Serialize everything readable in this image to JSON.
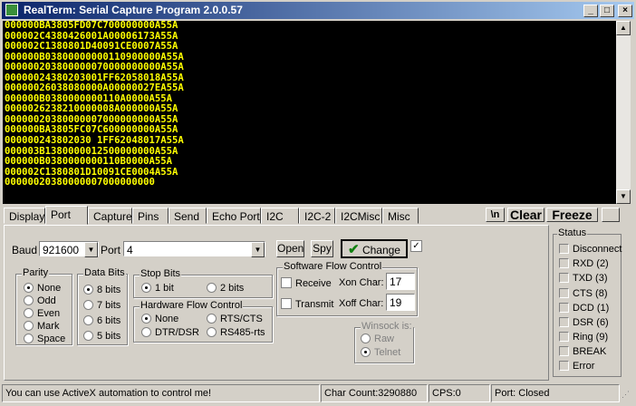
{
  "window": {
    "title": "RealTerm: Serial Capture Program 2.0.0.57",
    "min": "_",
    "max": "□",
    "close": "×"
  },
  "terminal": {
    "lines": [
      "000000BA3805FD07C700000000A55A",
      "000002C4380426001A00006173A55A",
      "000002C1380801D40091CE0007A55A",
      "000000B03800000000110900000A55A",
      "000000203800000070000000000A55A",
      "00000024380203001FF62058018A55A",
      "00000026038080000A00000027EA55A",
      "000000B0380000000110A0000A55A",
      "0000026238210000008A000000A55A",
      "00000020380000007000000000A55A",
      "000000BA3805FC07C600000000A55A",
      "000000243802030 1FF62048017A55A",
      "000003B1380000012500000000A55A",
      "000000B0380000000110B0000A55A",
      "000002C1380801D10091CE0004A55A",
      "00000020380000007000000000"
    ],
    "scroll_up": "▲",
    "scroll_down": "▼"
  },
  "tabs": [
    "Display",
    "Port",
    "Capture",
    "Pins",
    "Send",
    "Echo Port",
    "I2C",
    "I2C-2",
    "I2CMisc",
    "Misc"
  ],
  "right_buttons": {
    "newline": "\\n",
    "clear": "Clear",
    "freeze": "Freeze"
  },
  "port": {
    "baud_label": "Baud",
    "baud_value": "921600",
    "port_label": "Port",
    "port_value": "4",
    "open": "Open",
    "spy": "Spy",
    "change": "Change",
    "parity": {
      "label": "Parity",
      "options": [
        "None",
        "Odd",
        "Even",
        "Mark",
        "Space"
      ]
    },
    "data_bits": {
      "label": "Data Bits",
      "options": [
        "8 bits",
        "7 bits",
        "6 bits",
        "5 bits"
      ]
    },
    "stop_bits": {
      "label": "Stop Bits",
      "one": "1 bit",
      "two": "2 bits"
    },
    "hw_flow": {
      "label": "Hardware Flow Control",
      "none": "None",
      "rts_cts": "RTS/CTS",
      "dtr_dsr": "DTR/DSR",
      "rs485": "RS485-rts"
    },
    "sw_flow": {
      "label": "Software Flow Control",
      "receive": "Receive",
      "xon_label": "Xon Char:",
      "xon": "17",
      "transmit": "Transmit",
      "xoff_label": "Xoff Char:",
      "xoff": "19"
    },
    "winsock": {
      "label": "Winsock is:",
      "raw": "Raw",
      "telnet": "Telnet"
    }
  },
  "status": {
    "label": "Status",
    "items": [
      "Disconnect",
      "RXD (2)",
      "TXD (3)",
      "CTS (8)",
      "DCD (1)",
      "DSR (6)",
      "Ring (9)",
      "BREAK",
      "Error"
    ]
  },
  "statusbar": {
    "message": "You can use ActiveX automation to control me!",
    "char_count": "Char Count:3290880",
    "cps": "CPS:0",
    "port": "Port: Closed"
  },
  "colors": {
    "terminal_bg": "#000000",
    "terminal_text": "#ffff00",
    "title_start": "#0a246a",
    "title_end": "#a6caf0"
  }
}
